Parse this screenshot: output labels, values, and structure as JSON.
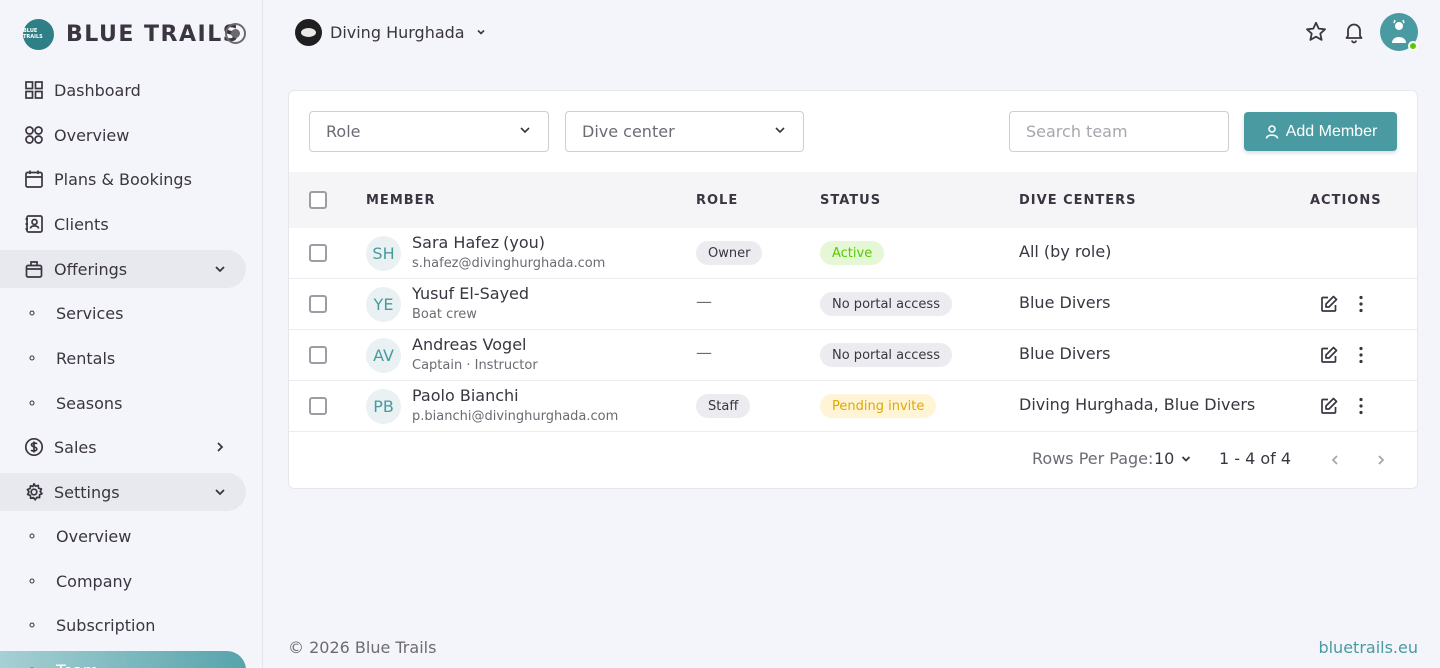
{
  "brand": {
    "name": "BLUE TRAILS",
    "logo_text": "BLUE TRAILS"
  },
  "sidebar": {
    "items": [
      {
        "label": "Dashboard",
        "icon": "grid-icon"
      },
      {
        "label": "Overview",
        "icon": "circles-icon"
      },
      {
        "label": "Plans & Bookings",
        "icon": "calendar-icon"
      },
      {
        "label": "Clients",
        "icon": "contacts-icon"
      },
      {
        "label": "Offerings",
        "icon": "box-icon",
        "expanded": true
      },
      {
        "label": "Services",
        "icon": "dot-icon",
        "sub": true
      },
      {
        "label": "Rentals",
        "icon": "dot-icon",
        "sub": true
      },
      {
        "label": "Seasons",
        "icon": "dot-icon",
        "sub": true
      },
      {
        "label": "Sales",
        "icon": "dollar-icon"
      },
      {
        "label": "Settings",
        "icon": "gear-icon",
        "expanded": true
      },
      {
        "label": "Overview",
        "icon": "dot-icon",
        "sub": true
      },
      {
        "label": "Company",
        "icon": "dot-icon",
        "sub": true
      },
      {
        "label": "Subscription",
        "icon": "dot-icon",
        "sub": true
      },
      {
        "label": "Team",
        "icon": "dot-icon",
        "sub": true,
        "active": true
      }
    ]
  },
  "topbar": {
    "org_name": "Diving Hurghada"
  },
  "filters": {
    "role_label": "Role",
    "center_label": "Dive center",
    "search_placeholder": "Search team",
    "add_label": "Add Member"
  },
  "table": {
    "headers": {
      "member": "MEMBER",
      "role": "ROLE",
      "status": "STATUS",
      "centers": "DIVE CENTERS",
      "actions": "ACTIONS"
    },
    "rows": [
      {
        "initials": "SH",
        "name": "Sara Hafez",
        "you": "(you)",
        "sub": "s.hafez@divinghurghada.com",
        "role": "Owner",
        "status": "Active",
        "status_kind": "green",
        "centers": "All (by role)",
        "actions": false
      },
      {
        "initials": "YE",
        "name": "Yusuf El-Sayed",
        "you": "",
        "sub": "Boat crew",
        "role": "—",
        "status": "No portal access",
        "status_kind": "grey",
        "centers": "Blue Divers",
        "actions": true
      },
      {
        "initials": "AV",
        "name": "Andreas Vogel",
        "you": "",
        "sub": "Captain · Instructor",
        "role": "—",
        "status": "No portal access",
        "status_kind": "grey",
        "centers": "Blue Divers",
        "actions": true
      },
      {
        "initials": "PB",
        "name": "Paolo Bianchi",
        "you": "",
        "sub": "p.bianchi@divinghurghada.com",
        "role": "Staff",
        "status": "Pending invite",
        "status_kind": "yellow",
        "centers": "Diving Hurghada, Blue Divers",
        "actions": true
      }
    ]
  },
  "pagination": {
    "rows_label": "Rows Per Page:",
    "page_size": "10",
    "range": "1 - 4 of 4"
  },
  "footer": {
    "copyright": "© 2026 Blue Trails",
    "link": "bluetrails.eu"
  },
  "colors": {
    "accent": "#4a9aa1",
    "active_green": "#56ca00",
    "pending_yellow": "#e0a800"
  }
}
